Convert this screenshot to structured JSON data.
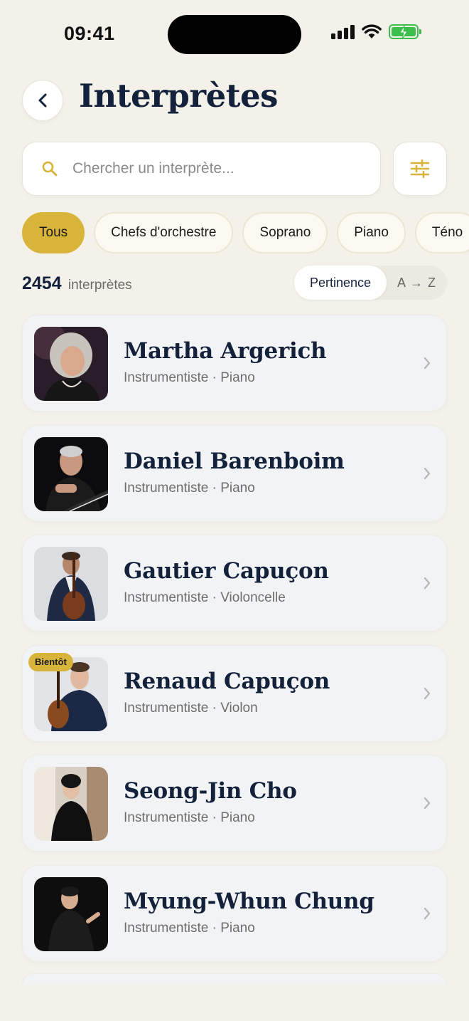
{
  "status_bar": {
    "time": "09:41"
  },
  "header": {
    "title": "Interprètes"
  },
  "search": {
    "placeholder": "Chercher un interprète..."
  },
  "filters": {
    "chips": [
      {
        "label": "Tous",
        "active": true
      },
      {
        "label": "Chefs d'orchestre",
        "active": false
      },
      {
        "label": "Soprano",
        "active": false
      },
      {
        "label": "Piano",
        "active": false
      },
      {
        "label": "Téno",
        "active": false
      }
    ]
  },
  "results": {
    "count": "2454",
    "count_label": "interprètes",
    "sort": {
      "selected": "Pertinence",
      "alternate": "A → Z"
    }
  },
  "performers": [
    {
      "name": "Martha Argerich",
      "subtitle": "Instrumentiste · Piano"
    },
    {
      "name": "Daniel Barenboim",
      "subtitle": "Instrumentiste · Piano"
    },
    {
      "name": "Gautier Capuçon",
      "subtitle": "Instrumentiste · Violoncelle"
    },
    {
      "name": "Renaud Capuçon",
      "subtitle": "Instrumentiste · Violon",
      "badge": "Bientôt"
    },
    {
      "name": "Seong-Jin Cho",
      "subtitle": "Instrumentiste · Piano"
    },
    {
      "name": "Myung-Whun Chung",
      "subtitle": "Instrumentiste · Piano"
    }
  ],
  "colors": {
    "accent": "#d8b43a",
    "background": "#f3f1ea",
    "title": "#14213b"
  }
}
